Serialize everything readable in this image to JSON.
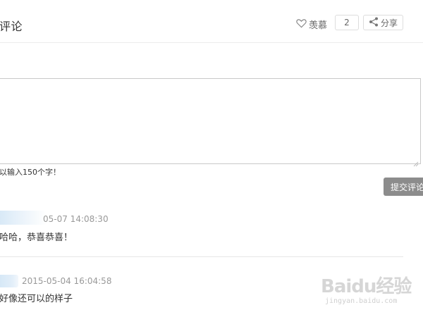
{
  "header": {
    "title": "评论",
    "like_label": "羡慕",
    "like_count": "2",
    "share_label": "分享"
  },
  "editor": {
    "char_hint": "以输入150个字！",
    "submit_label": "提交评论"
  },
  "comments": [
    {
      "time": "05-07 14:08:30",
      "text": "哈哈，恭喜恭喜！"
    },
    {
      "time": "2015-05-04 16:04:58",
      "text": "好像还可以的样子"
    }
  ],
  "watermark": {
    "main": "Baidu经验",
    "sub": "jingyan.baidu.com"
  }
}
